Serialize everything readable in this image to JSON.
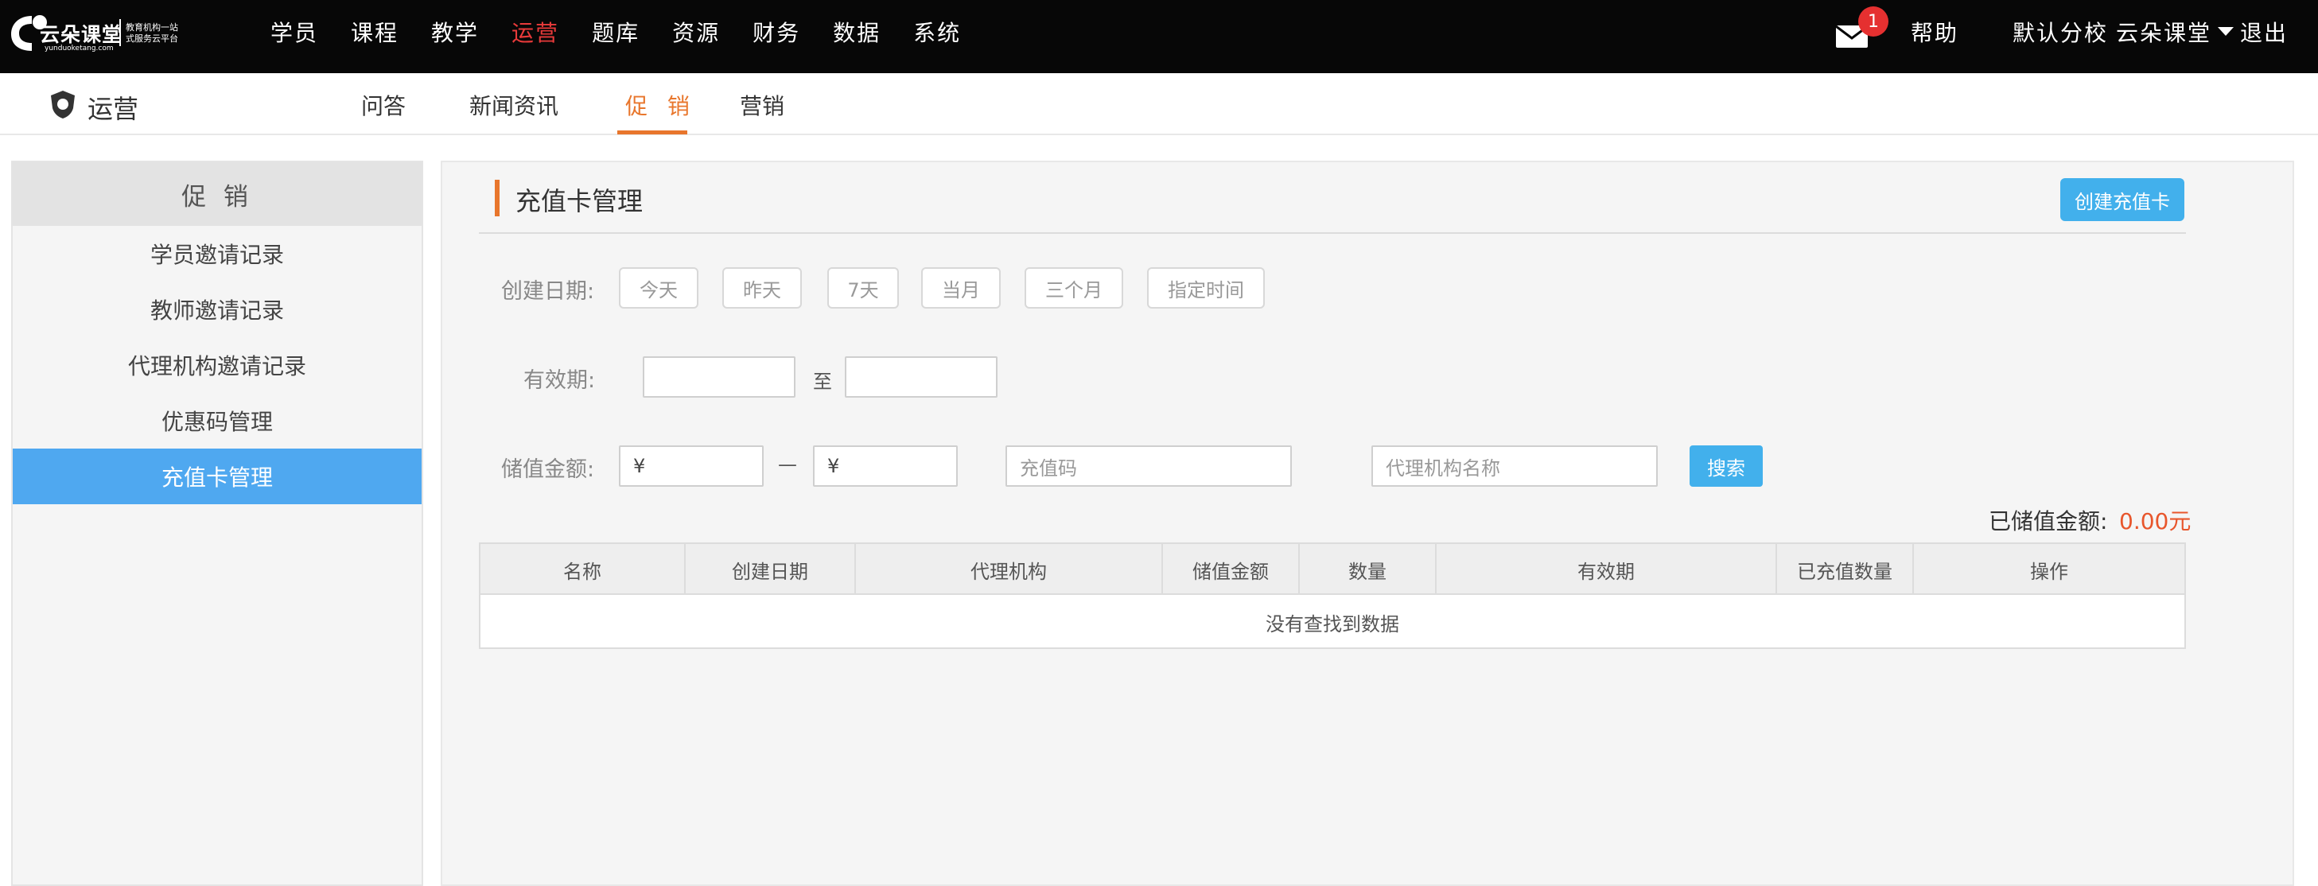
{
  "logo": {
    "main": "云朵课堂",
    "sub": "yunduoketang.com",
    "slogan_line1": "教育机构一站",
    "slogan_line2": "式服务云平台"
  },
  "topnav": {
    "items": [
      {
        "label": "学员"
      },
      {
        "label": "课程"
      },
      {
        "label": "教学"
      },
      {
        "label": "运营",
        "active": true
      },
      {
        "label": "题库"
      },
      {
        "label": "资源"
      },
      {
        "label": "财务"
      },
      {
        "label": "数据"
      },
      {
        "label": "系统"
      }
    ],
    "active_color": "#e83a3a"
  },
  "topright": {
    "mail_badge": "1",
    "help": "帮助",
    "branch": "默认分校",
    "user": "云朵课堂",
    "logout": "退出"
  },
  "module": {
    "title": "运营",
    "icon": "shield-icon"
  },
  "subnav": {
    "items": [
      {
        "label": "问答"
      },
      {
        "label": "新闻资讯"
      },
      {
        "label": "促销",
        "active": true
      },
      {
        "label": "营销"
      }
    ],
    "active_display": "促 销",
    "accent": "#e8762c"
  },
  "sidebar": {
    "title": "促 销",
    "items": [
      {
        "label": "学员邀请记录"
      },
      {
        "label": "教师邀请记录"
      },
      {
        "label": "代理机构邀请记录"
      },
      {
        "label": "优惠码管理"
      },
      {
        "label": "充值卡管理",
        "active": true
      }
    ],
    "active_color": "#4fa8f0"
  },
  "main": {
    "title": "充值卡管理",
    "create_button": "创建充值卡",
    "filters": {
      "created_label": "创建日期:",
      "date_chips": [
        "今天",
        "昨天",
        "7天",
        "当月",
        "三个月",
        "指定时间"
      ],
      "validity_label": "有效期:",
      "validity_from": "",
      "validity_to_text": "至",
      "validity_to": "",
      "amount_label": "储值金额:",
      "amount_min": "¥",
      "amount_dash": "—",
      "amount_max": "¥",
      "card_code_placeholder": "充值码",
      "agency_placeholder": "代理机构名称",
      "search_button": "搜索"
    },
    "stored_label": "已储值金额:",
    "stored_value": "0.00元",
    "table": {
      "columns": [
        "名称",
        "创建日期",
        "代理机构",
        "储值金额",
        "数量",
        "有效期",
        "已充值数量",
        "操作"
      ],
      "empty_text": "没有查找到数据"
    }
  },
  "colors": {
    "topbar": "#070707",
    "primary_button": "#42b0ec",
    "accent_orange": "#e8762c",
    "amount_red": "#e8562c"
  }
}
